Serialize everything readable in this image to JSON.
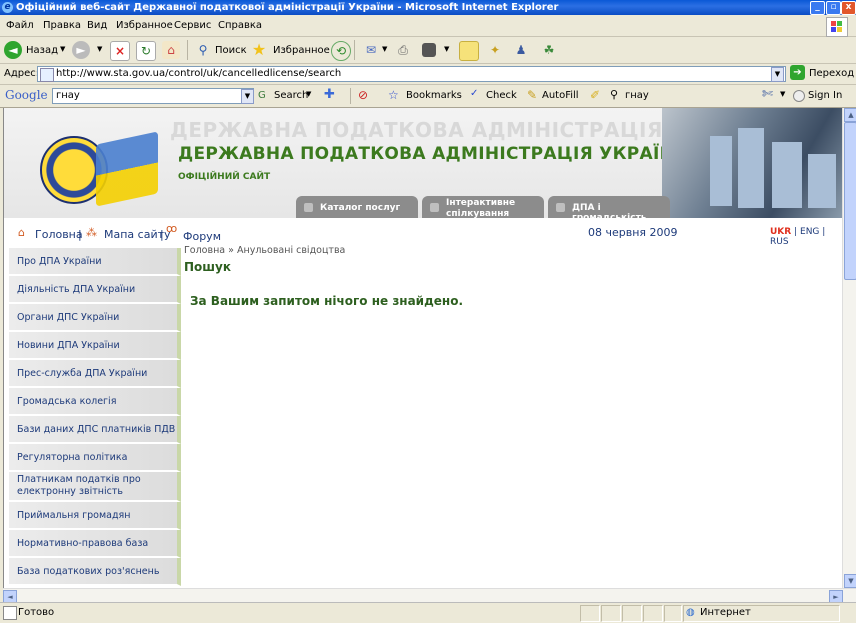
{
  "window": {
    "title": "Офіційний веб-сайт Державної податкової адміністрації України - Microsoft Internet Explorer",
    "buttons": [
      "_",
      "▫",
      "x"
    ]
  },
  "menubar": {
    "items": [
      "Файл",
      "Правка",
      "Вид",
      "Избранное",
      "Сервис",
      "Справка"
    ]
  },
  "toolbar": {
    "back_label": "Назад",
    "search_label": "Поиск",
    "favorites_label": "Избранное"
  },
  "address": {
    "label": "Адрес:",
    "url": "http://www.sta.gov.ua/control/uk/cancelledlicense/search",
    "go_label": "Переход"
  },
  "google_bar": {
    "logo": "Google",
    "query": "гнау",
    "search_label": "Search",
    "bookmarks_label": "Bookmarks",
    "check_label": "Check",
    "autofill_label": "AutoFill",
    "highlight_label": "гнау",
    "signin_label": "Sign In"
  },
  "site": {
    "header_shadow": "ДЕРЖАВНА ПОДАТКОВА АДМІНІСТРАЦІЯ УКРАЇНИ",
    "title": "ДЕРЖАВНА ПОДАТКОВА АДМІНІСТРАЦІЯ УКРАЇНИ",
    "subtitle": "ОФІЦІЙНИЙ САЙТ",
    "tabs": [
      {
        "label": "Каталог послуг"
      },
      {
        "label": "Інтерактивне спілкування"
      },
      {
        "label": "ДПА і громадськість"
      }
    ],
    "toplinks": {
      "home": "Головна",
      "sitemap": "Мапа сайту",
      "forum": "Форум",
      "sep1": "|",
      "sep2": "|"
    },
    "date": "08 червня 2009",
    "langs": {
      "ukr": "UKR",
      "eng": "ENG",
      "rus": "RUS",
      "sep": "|"
    },
    "sidebar": [
      "Про ДПА України",
      "Діяльність ДПА України",
      "Органи ДПС України",
      "Новини ДПА України",
      "Прес-служба ДПА України",
      "Громадська колегія",
      "Бази даних ДПС платників ПДВ",
      "Регуляторна політика",
      "Платникам податків про електронну звітність",
      "Приймальня громадян",
      "Нормативно-правова база",
      "База податкових роз'яснень"
    ],
    "breadcrumb": {
      "home": "Головна",
      "arrow": "»",
      "current": "Анульовані свідоцтва"
    },
    "page_title": "Пошук",
    "result_text": "За Вашим запитом нічого не знайдено."
  },
  "status": {
    "text": "Готово",
    "zone": "Интернет"
  }
}
